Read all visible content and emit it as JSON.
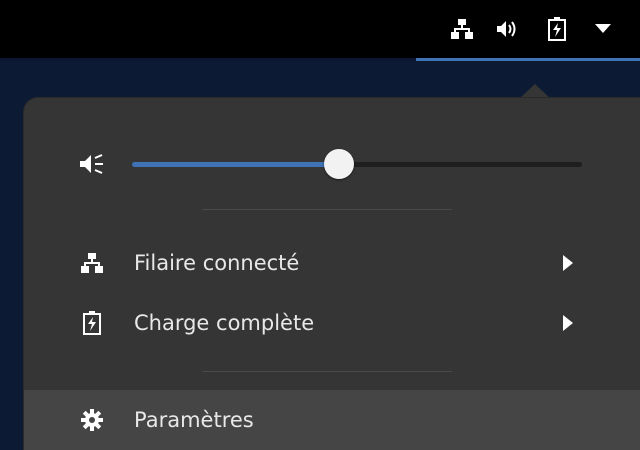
{
  "topbar": {
    "tray_icons": [
      "network-wired-icon",
      "volume-icon",
      "battery-charging-icon",
      "chevron-down-icon"
    ]
  },
  "menu": {
    "volume": {
      "icon": "volume-muted-icon",
      "level": 0.46
    },
    "items": [
      {
        "icon": "network-wired-icon",
        "label": "Filaire connecté",
        "has_submenu": true
      },
      {
        "icon": "battery-charging-icon",
        "label": "Charge complète",
        "has_submenu": true
      }
    ],
    "settings": {
      "icon": "gear-icon",
      "label": "Paramètres"
    }
  },
  "colors": {
    "accent": "#3f73b6",
    "menu_bg": "#353535",
    "topbar_bg": "#000000",
    "highlight_bg": "#454545"
  }
}
